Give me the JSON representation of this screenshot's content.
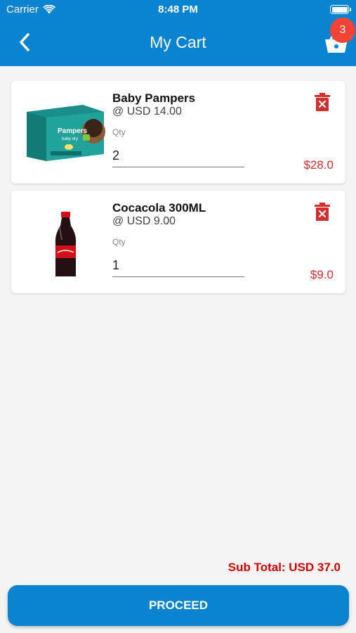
{
  "status_bar": {
    "carrier": "Carrier",
    "time": "8:48 PM"
  },
  "header": {
    "title": "My Cart",
    "back_icon": "chevron-left-icon",
    "cart_icon": "basket-icon",
    "cart_count": "3"
  },
  "items": [
    {
      "name": "Baby Pampers",
      "unit_price": "@ USD 14.00",
      "qty_label": "Qty",
      "qty": "2",
      "line_total": "$28.0"
    },
    {
      "name": "Cocacola 300ML",
      "unit_price": "@ USD 9.00",
      "qty_label": "Qty",
      "qty": "1",
      "line_total": "$9.0"
    }
  ],
  "footer": {
    "subtotal": "Sub Total: USD 37.0",
    "proceed_label": "PROCEED"
  },
  "colors": {
    "primary": "#0a83d1",
    "danger": "#d32f2f",
    "badge": "#f44336"
  }
}
